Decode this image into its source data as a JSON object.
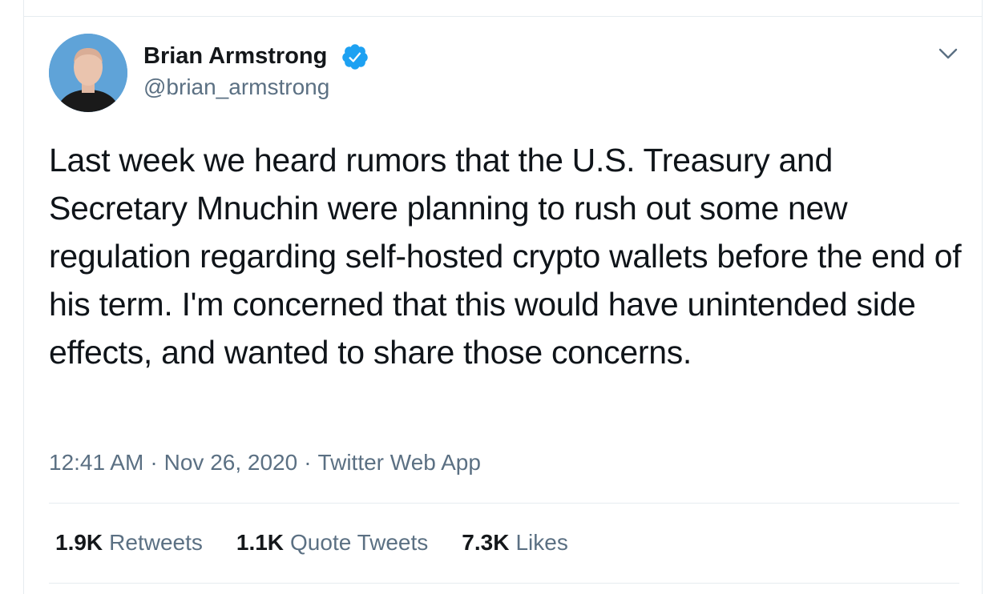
{
  "author": {
    "name": "Brian Armstrong",
    "handle": "@brian_armstrong",
    "verified": true,
    "avatar_icon": "profile-photo"
  },
  "tweet": {
    "text": "Last week we heard rumors that the U.S. Treasury and Secretary Mnuchin were planning to rush out some new regulation regarding self-hosted crypto wallets before the end of his term. I'm concerned that this would have unintended side effects, and wanted to share those concerns."
  },
  "meta": {
    "time": "12:41 AM",
    "separator": "·",
    "date": "Nov 26, 2020",
    "source": "Twitter Web App"
  },
  "stats": {
    "retweets_count": "1.9K",
    "retweets_label": "Retweets",
    "quote_count": "1.1K",
    "quote_label": "Quote Tweets",
    "likes_count": "7.3K",
    "likes_label": "Likes"
  },
  "colors": {
    "verified": "#1da1f2",
    "secondary_text": "#5b7083",
    "primary_text": "#0f1419",
    "divider": "#e6ecf0"
  }
}
